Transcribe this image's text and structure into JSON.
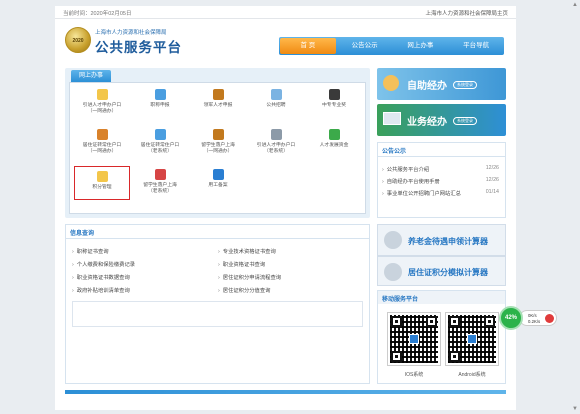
{
  "header": {
    "date_text": "当前时间：2020年02月05日",
    "home_link": "上海市人力资源和社会保障局主页",
    "logo_year": "2020",
    "org_name": "上海市人力资源和社会保障局",
    "site_name": "公共服务平台"
  },
  "nav": [
    "首 页",
    "公告公示",
    "网上办事",
    "平台导航"
  ],
  "online_services": {
    "title": "网上办事",
    "items": [
      {
        "label": "引进人才申办户口\n（一网通办）",
        "icon": "document-icon",
        "color": "#f3c64a"
      },
      {
        "label": "职称申报",
        "icon": "certificate-icon",
        "color": "#4a9ee0"
      },
      {
        "label": "领军人才申报",
        "icon": "briefcase-icon",
        "color": "#c2791e"
      },
      {
        "label": "公共招聘",
        "icon": "recruitment-icon",
        "color": "#7bb3e2"
      },
      {
        "label": "中专专业奖",
        "icon": "graduate-icon",
        "color": "#3a3a3a"
      },
      {
        "label": "居住证转常住户口\n（一网通办）",
        "icon": "family-icon",
        "color": "#d9822b"
      },
      {
        "label": "居住证转常住户口\n（老系统）",
        "icon": "certificate-icon",
        "color": "#4a9ee0"
      },
      {
        "label": "留学生落户上海\n（一网通办）",
        "icon": "briefcase-icon",
        "color": "#c2791e"
      },
      {
        "label": "引进人才申办户口\n（老系统）",
        "icon": "form-icon",
        "color": "#8c9aa8"
      },
      {
        "label": "人才发展资金",
        "icon": "tree-icon",
        "color": "#3caa4a"
      },
      {
        "label": "积分管理",
        "icon": "coins-icon",
        "color": "#f3c64a"
      },
      {
        "label": "留学生落户上海\n（老系统）",
        "icon": "exit-icon",
        "color": "#d64545"
      },
      {
        "label": "用工备案",
        "icon": "list-icon",
        "color": "#2a7ed2"
      }
    ]
  },
  "info_query": {
    "title": "信息查询",
    "left": [
      "职称证书查询",
      "个人缴费和保险缴费记录",
      "职业资格证书数据查询",
      "政府补贴培训清单查询"
    ],
    "right": [
      "专业技术资格证书查询",
      "职业资格证书查询",
      "居住证积分申请流程查询",
      "居住证积分分值查询"
    ]
  },
  "banners": {
    "top": {
      "title": "自助经办",
      "sub": "系统登录"
    },
    "bottom": {
      "title": "业务经办",
      "sub": "系统登录"
    }
  },
  "notices": {
    "title": "公告公示",
    "items": [
      {
        "text": "公共服务平台介绍",
        "date": "12/26"
      },
      {
        "text": "自助经办平台使用手册",
        "date": "12/26"
      },
      {
        "text": "事业单位公开招聘门户网站汇总",
        "date": "01/14"
      }
    ]
  },
  "calculators": [
    "养老金待遇申领计算器",
    "居住证积分模拟计算器"
  ],
  "mobile": {
    "title": "移动服务平台",
    "ios": "IOS系统",
    "android": "Android系统"
  },
  "speed_widget": {
    "percent": "42%",
    "up": "0K/s",
    "down": "0.2K/s"
  }
}
